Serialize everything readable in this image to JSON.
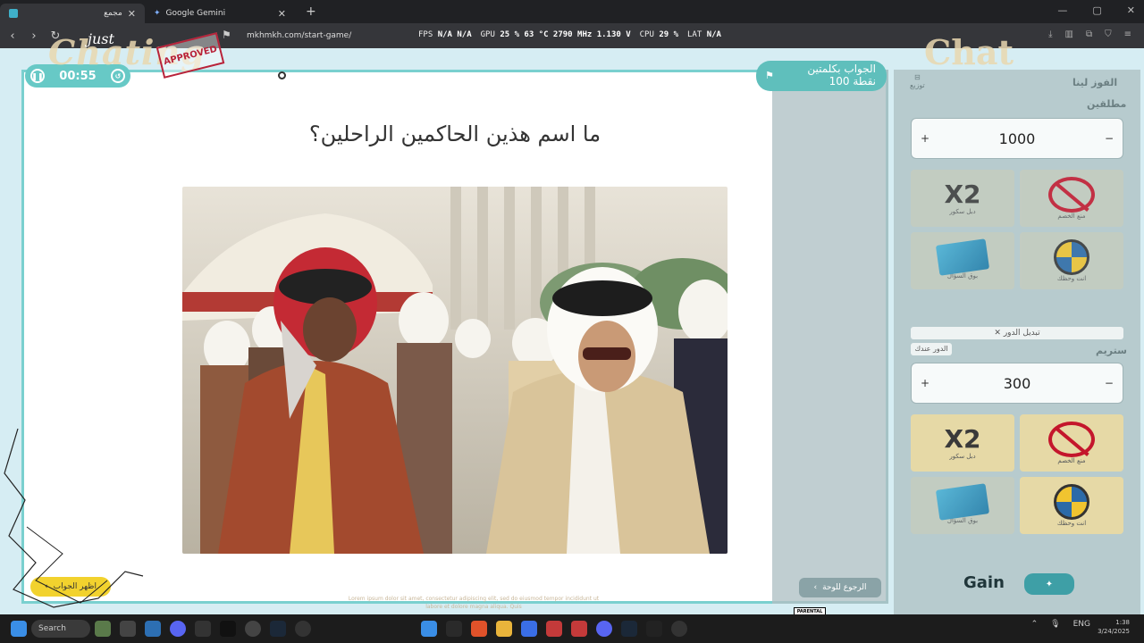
{
  "browser": {
    "tabs": [
      {
        "label": "مجمع",
        "active": true
      },
      {
        "label": "Google Gemini",
        "active": false
      }
    ],
    "url": "mkhmkh.com/start-game/",
    "perf": {
      "fps_label": "FPS",
      "fps_value": "N/A",
      "fps_value2": "N/A",
      "gpu_label": "GPU",
      "gpu_value": "25 % 63 °C 2790 MHz 1.130 V",
      "cpu_label": "CPU",
      "cpu_value": "29 %",
      "lat_label": "LAT",
      "lat_value": "N/A"
    }
  },
  "overlay": {
    "just": "just",
    "chatting": "Chating",
    "stamp": "APPROVED",
    "chat": "Chat"
  },
  "game": {
    "timer": "00:55",
    "question": "ما اسم هذين الحاكمين الراحلين؟",
    "points_line1": "الجواب بكلمتين",
    "points_line2": "100 نقطة",
    "show_answer": "اظهر الجواب",
    "back_to_board": "الرجوع للوحة",
    "footer_text": "Lorem ipsum dolor sit amet, consectetur adipiscing elit, sed do eiusmod tempor incididunt ut labore et dolore magna aliqua. Quis"
  },
  "teams": {
    "win_label": "الفوز لينا",
    "win_icon_label": "توزيع",
    "team1": {
      "name": "مطلقين",
      "score": "1000"
    },
    "team2": {
      "name": "ستريم",
      "score": "300"
    },
    "swap_label": "تبديل الدور",
    "turn_label": "الدور عندك",
    "tools": {
      "double": "دبل سكور",
      "block": "منع الخصم",
      "steal": "بوق السؤال",
      "wheel": "انت وحظك"
    },
    "brand": "Gain"
  },
  "taskbar": {
    "search": "Search",
    "lang": "ENG",
    "time": "1:38",
    "date": "3/24/2025"
  },
  "advisory": "PARENTAL ADVISORY EXPLICIT CONTENT"
}
